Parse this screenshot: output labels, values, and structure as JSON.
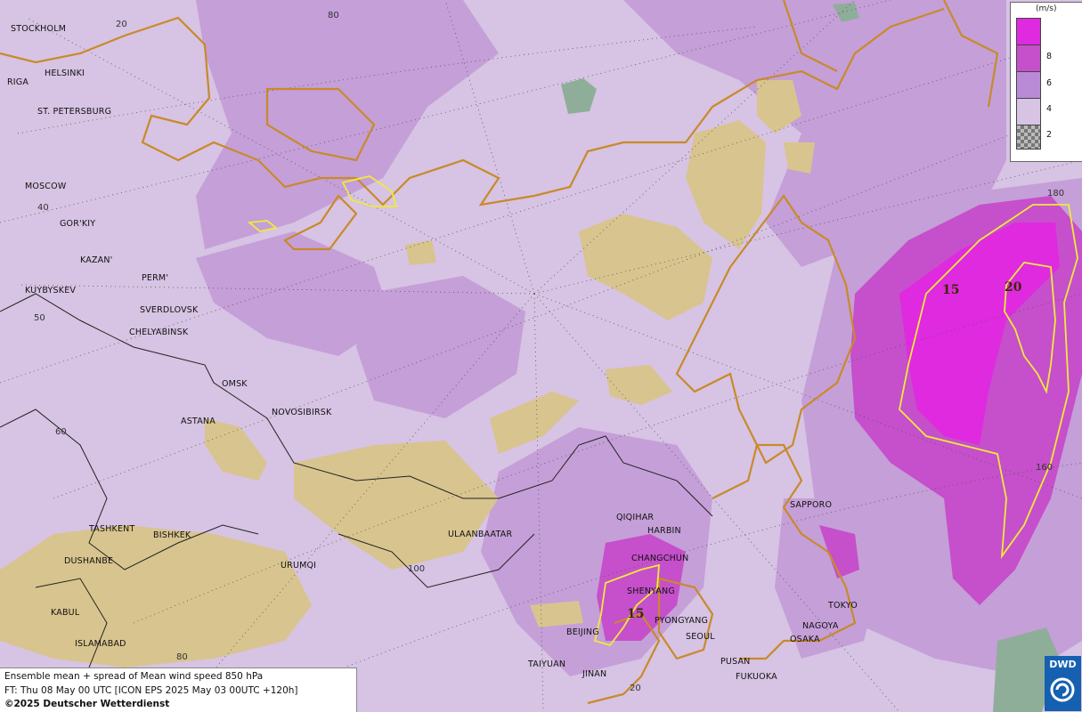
{
  "map": {
    "colors": {
      "base": "#d7c3e3",
      "light": "#c59fd8",
      "mid": "#b57fcc",
      "strong": "#c64fcb",
      "max": "#df2adf",
      "terrain": "#d8c48e",
      "sea": "#8fae9a",
      "coast": "#c88a2a",
      "contour": "#f0ea3a"
    },
    "icons": [
      "coastline",
      "border",
      "graticule",
      "contour-line"
    ]
  },
  "legend": {
    "unit": "(m/s)",
    "swatch_colors": [
      "#df2adf",
      "#c64fcb",
      "#b98ad6",
      "#d7c3e3",
      "checker"
    ],
    "levels": [
      "8",
      "6",
      "4",
      "2"
    ]
  },
  "cities": [
    {
      "name": "STOCKHOLM"
    },
    {
      "name": "HELSINKI"
    },
    {
      "name": "RIGA"
    },
    {
      "name": "ST. PETERSBURG"
    },
    {
      "name": "MOSCOW"
    },
    {
      "name": "GOR'KIY"
    },
    {
      "name": "KAZAN'"
    },
    {
      "name": "PERM'"
    },
    {
      "name": "KUYBYSKEV"
    },
    {
      "name": "SVERDLOVSK"
    },
    {
      "name": "CHELYABINSK"
    },
    {
      "name": "OMSK"
    },
    {
      "name": "NOVOSIBIRSK"
    },
    {
      "name": "ASTANA"
    },
    {
      "name": "TASHKENT"
    },
    {
      "name": "BISHKEK"
    },
    {
      "name": "DUSHANBE"
    },
    {
      "name": "URUMQI"
    },
    {
      "name": "KABUL"
    },
    {
      "name": "ISLAMABAD"
    },
    {
      "name": "ULAANBAATAR"
    },
    {
      "name": "QIQIHAR"
    },
    {
      "name": "HARBIN"
    },
    {
      "name": "CHANGCHUN"
    },
    {
      "name": "SHENYANG"
    },
    {
      "name": "BEIJING"
    },
    {
      "name": "TAIYUAN"
    },
    {
      "name": "JINAN"
    },
    {
      "name": "PYONGYANG"
    },
    {
      "name": "SEOUL"
    },
    {
      "name": "PUSAN"
    },
    {
      "name": "FUKUOKA"
    },
    {
      "name": "OSAKA"
    },
    {
      "name": "NAGOYA"
    },
    {
      "name": "TOKYO"
    },
    {
      "name": "SAPPORO"
    }
  ],
  "graticule_labels": [
    "20",
    "80",
    "40",
    "50",
    "60",
    "100",
    "80",
    "20",
    "180",
    "160"
  ],
  "contour_labels": [
    "15",
    "20",
    "15"
  ],
  "caption": {
    "line1": "Ensemble mean + spread of Mean wind speed 850 hPa",
    "line2": "FT: Thu 08 May 00 UTC [ICON EPS 2025 May 03 00UTC +120h]",
    "line3": "©2025 Deutscher Wetterdienst"
  },
  "logo": {
    "text": "DWD"
  }
}
